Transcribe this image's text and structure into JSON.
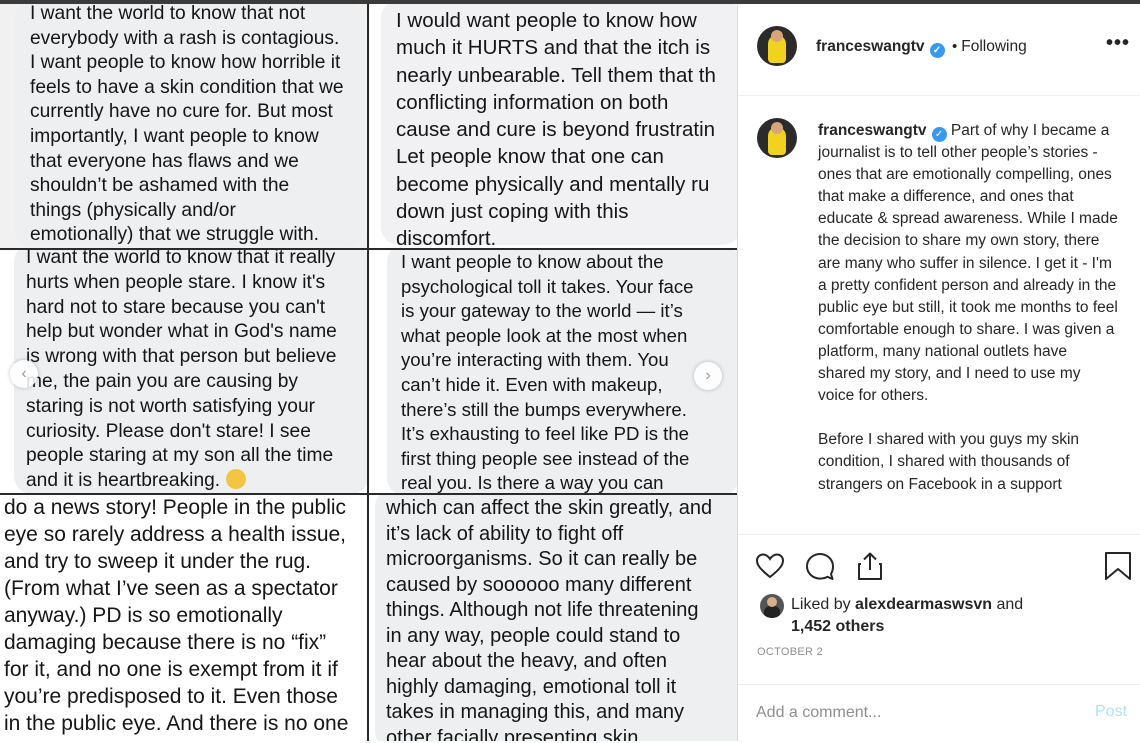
{
  "collage": {
    "cell1": "I want the world to know that not\neverybody with a rash is contagious.\nI want people to know how horrible it\nfeels to have a skin condition that we\ncurrently have no cure for. But most\nimportantly, I want people to know\nthat everyone has flaws and we\nshouldn’t be ashamed with the\nthings (physically and/or\nemotionally) that we struggle with.",
    "cell2": "I would want people to know how\nmuch it HURTS and that the itch is\nnearly unbearable. Tell them that th\nconflicting information on both\ncause and cure is beyond frustratin\nLet people know that one can\nbecome physically and mentally ru\ndown just coping with this\ndiscomfort.",
    "cell3": "I want the world to know that it really\nhurts when people stare. I know it's\nhard not to stare because you can't\nhelp but wonder what in God's name\nis wrong with that person but believe\nme, the pain you are causing by\nstaring is not worth satisfying your\ncuriosity. Please don't stare! I see\npeople staring at my son all the time\nand it is heartbreaking.",
    "cell4": "I want people to know about the\npsychological toll it takes. Your face\nis your gateway to the world — it’s\nwhat people look at the most when\nyou’re interacting with them. You\ncan’t hide it. Even with makeup,\nthere’s still the bumps everywhere.\nIt’s exhausting to feel like PD is the\nfirst thing people see instead of the\nreal you. Is there a way you can",
    "cell5": "do a news story! People in the public\neye so rarely address a health issue,\nand try to sweep it under the rug.\n(From what I’ve seen as a spectator\nanyway.) PD is so emotionally\ndamaging because there is no “fix”\nfor it, and no one is exempt from it if\nyou’re predisposed to it. Even those\nin the public eye. And there is no one\nsingle fit all cure to smooth or finally",
    "cell6": "which can affect the skin greatly, and\nit’s lack of ability to fight off\nmicroorganisms. So it can really be\ncaused by soooooo many different\nthings. Although not life threatening\nin any way, people could stand to\nhear about the heavy, and often\nhighly damaging, emotional toll it\ntakes in managing this, and many\nother facially presenting skin"
  },
  "header": {
    "username": "franceswangtv",
    "separator": "•",
    "follow_status": "Following",
    "more": "•••"
  },
  "caption": {
    "username": "franceswangtv",
    "text": "Part of why I became a journalist is to tell other people’s stories - ones that are emotionally compelling, ones that make a difference, and ones that educate & spread awareness. While I made the decision to share my own story, there are many who suffer in silence. I get it - I'm a pretty confident person and already in the public eye but still, it took me months to feel comfortable enough to share. I was given a platform, many national outlets have shared my story, and I need to use my voice for others.",
    "text2": "Before I shared with you guys my skin condition, I shared with thousands of strangers on Facebook in a support"
  },
  "likes": {
    "prefix": "Liked by",
    "liker": "alexdearmaswsvn",
    "and": "and",
    "others": "1,452 others"
  },
  "date": "OCTOBER 2",
  "comment": {
    "placeholder": "Add a comment...",
    "post_label": "Post"
  },
  "colors": {
    "verified": "#3897f0",
    "post_disabled": "#b2dffc",
    "text": "#262626",
    "muted": "#8e8e8e"
  },
  "icons": [
    "heart-icon",
    "comment-icon",
    "share-icon",
    "bookmark-icon",
    "verified-icon",
    "chevron-left-icon",
    "chevron-right-icon",
    "more-icon"
  ]
}
